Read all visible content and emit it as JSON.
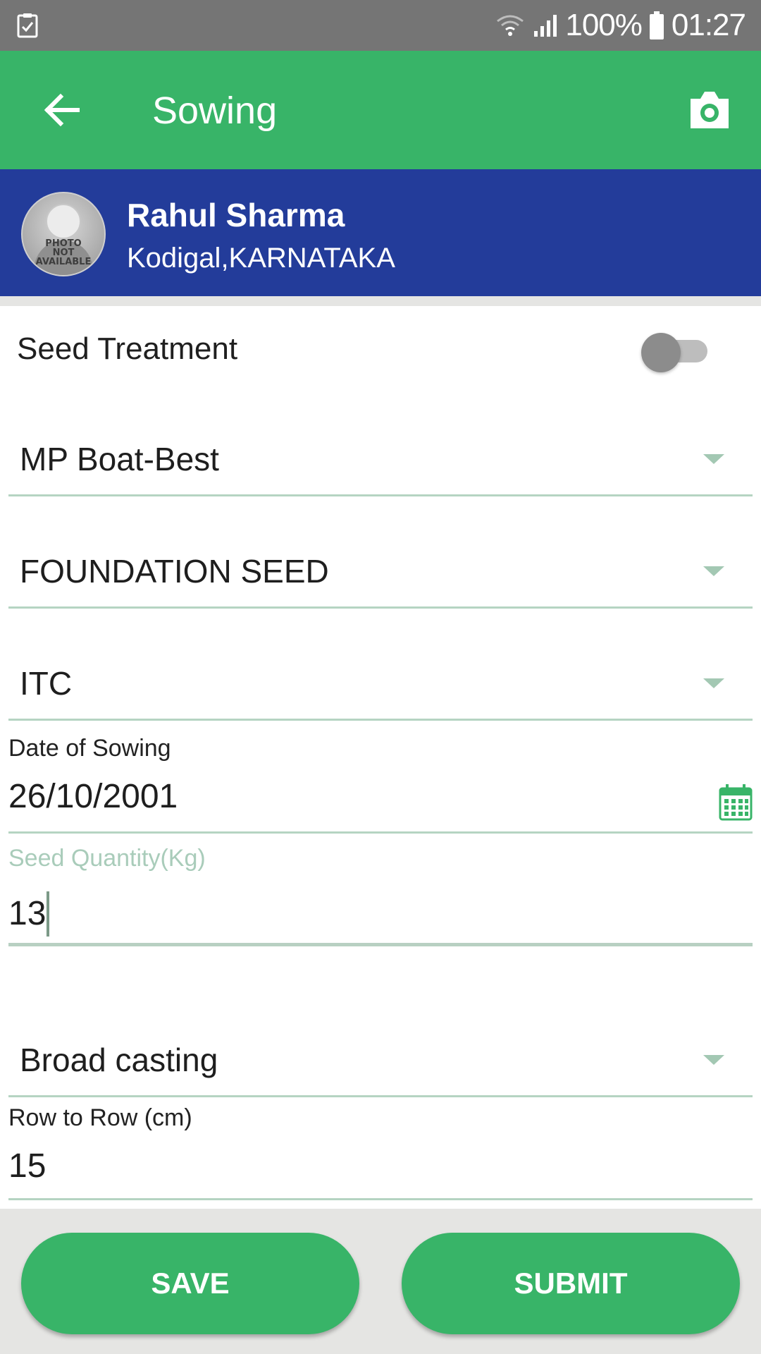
{
  "status_bar": {
    "battery": "100%",
    "time": "01:27"
  },
  "app_bar": {
    "title": "Sowing",
    "back_icon": "arrow-left-icon",
    "camera_icon": "camera-icon"
  },
  "profile": {
    "name": "Rahul Sharma",
    "location": "Kodigal,KARNATAKA",
    "avatar_text": [
      "PHOTO",
      "NOT",
      "AVAILABLE"
    ]
  },
  "form": {
    "seed_treatment": {
      "label": "Seed Treatment",
      "enabled": false
    },
    "variety": {
      "value": "MP Boat-Best"
    },
    "seed_class": {
      "value": "FOUNDATION SEED"
    },
    "company": {
      "value": "ITC"
    },
    "date_of_sowing": {
      "label": "Date of Sowing",
      "value": "26/10/2001"
    },
    "seed_quantity": {
      "label": "Seed Quantity(Kg)",
      "value": "13"
    },
    "sowing_method": {
      "value": "Broad casting"
    },
    "row_to_row": {
      "label": "Row to Row (cm)",
      "value": "15"
    }
  },
  "actions": {
    "save_label": "SAVE",
    "submit_label": "SUBMIT"
  },
  "colors": {
    "primary_green": "#38b468",
    "profile_blue": "#233c9a",
    "status_gray": "#757575"
  }
}
